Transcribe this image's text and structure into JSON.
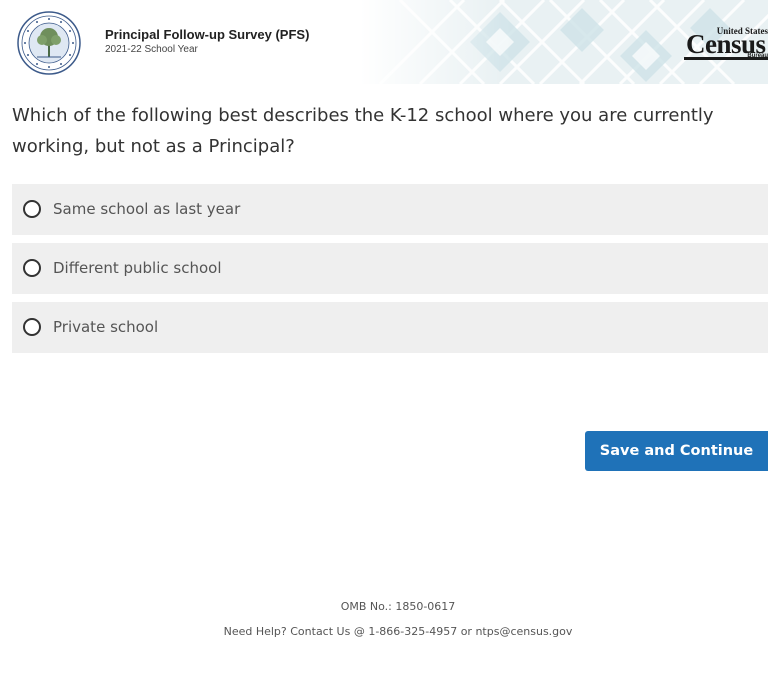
{
  "header": {
    "title": "Principal Follow-up Survey (PFS)",
    "school_year": "2021-22 School Year",
    "seal_icon": "department-of-education-seal",
    "logo": {
      "small_text": "United States",
      "big_text": "Census",
      "bureau_text": "Bureau"
    }
  },
  "question": {
    "text": "Which of the following best describes the K-12 school where you are currently working, but not as a Principal?"
  },
  "options": [
    {
      "label": "Same school as last year",
      "selected": false
    },
    {
      "label": "Different public school",
      "selected": false
    },
    {
      "label": "Private school",
      "selected": false
    }
  ],
  "actions": {
    "save_label": "Save and Continue"
  },
  "footer": {
    "omb": "OMB No.: 1850-0617",
    "help": "Need Help? Contact Us @ 1-866-325-4957 or ntps@census.gov"
  },
  "colors": {
    "primary_button": "#1f72b8",
    "option_background": "#efefef",
    "text": "#333333"
  }
}
